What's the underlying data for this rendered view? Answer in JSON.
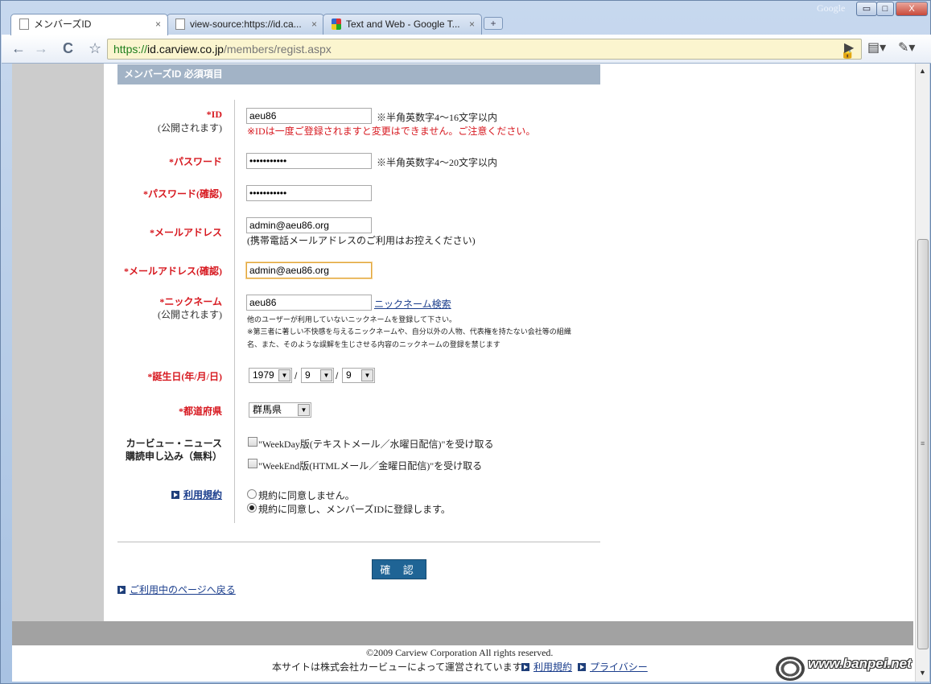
{
  "window": {
    "brand": "Google",
    "minimize": "▭",
    "maximize": "□",
    "close": "X"
  },
  "tabs": [
    {
      "title": "メンバーズID",
      "close": "×"
    },
    {
      "title": "view-source:https://id.ca...",
      "close": "×"
    },
    {
      "title": "Text and Web - Google T...",
      "close": "×"
    }
  ],
  "newtab": "+",
  "toolbar": {
    "back": "←",
    "forward": "→",
    "reload": "C",
    "star": "☆",
    "url_scheme": "https://",
    "url_host": "id.carview.co.jp",
    "url_path": "/members/regist.aspx",
    "lock": "🔒",
    "play": "▶",
    "page_menu": "▤▾",
    "wrench_menu": "✎▾"
  },
  "section_title": "メンバーズID 必須項目",
  "fields": {
    "id": {
      "label": "*ID",
      "sub": "(公開されます)",
      "value": "aeu86",
      "hint": "※半角英数字4～16文字以内",
      "warning": "※IDは一度ご登録されますと変更はできません。ご注意ください。"
    },
    "password": {
      "label": "*パスワード",
      "value": "•••••••••••",
      "hint": "※半角英数字4～20文字以内"
    },
    "password_confirm": {
      "label": "*パスワード(確認)",
      "value": "•••••••••••"
    },
    "email": {
      "label": "*メールアドレス",
      "value": "admin@aeu86.org",
      "hint": "(携帯電話メールアドレスのご利用はお控えください)"
    },
    "email_confirm": {
      "label": "*メールアドレス(確認)",
      "value": "admin@aeu86.org"
    },
    "nickname": {
      "label": "*ニックネーム",
      "sub": "(公開されます)",
      "value": "aeu86",
      "search_link": "ニックネーム検索",
      "note1": "他のユーザーが利用していないニックネームを登録して下さい。",
      "note2": "※第三者に著しい不快感を与えるニックネームや、自分以外の人物、代表権を持たない会社等の組織",
      "note3": "名、また、そのような誤解を生じさせる内容のニックネームの登録を禁じます"
    },
    "birthday": {
      "label": "*誕生日(年/月/日)",
      "year": "1979",
      "month": "9",
      "day": "9",
      "sep": "/",
      "arrow": "▼"
    },
    "prefecture": {
      "label": "*都道府県",
      "value": "群馬県"
    },
    "newsletter": {
      "label1": "カービュー・ニュース",
      "label2": "購読申し込み（無料）",
      "opt1": "\"WeekDay版(テキストメール／水曜日配信)\"を受け取る",
      "opt2": "\"WeekEnd版(HTMLメール／金曜日配信)\"を受け取る"
    },
    "terms": {
      "label": "利用規約",
      "opt_disagree": "規約に同意しません。",
      "opt_agree": "規約に同意し、メンバーズIDに登録します。"
    }
  },
  "confirm_button": "確 認",
  "back_link": "ご利用中のページへ戻る",
  "footer": {
    "copyright": "©2009 Carview Corporation All rights reserved.",
    "operated": "本サイトは株式会社カービューによって運営されています。",
    "terms_link": "利用規約",
    "privacy_link": "プライバシー"
  },
  "watermark": "www.banpei.net",
  "scroll": {
    "up": "▲",
    "down": "▼",
    "grip": "≡"
  }
}
